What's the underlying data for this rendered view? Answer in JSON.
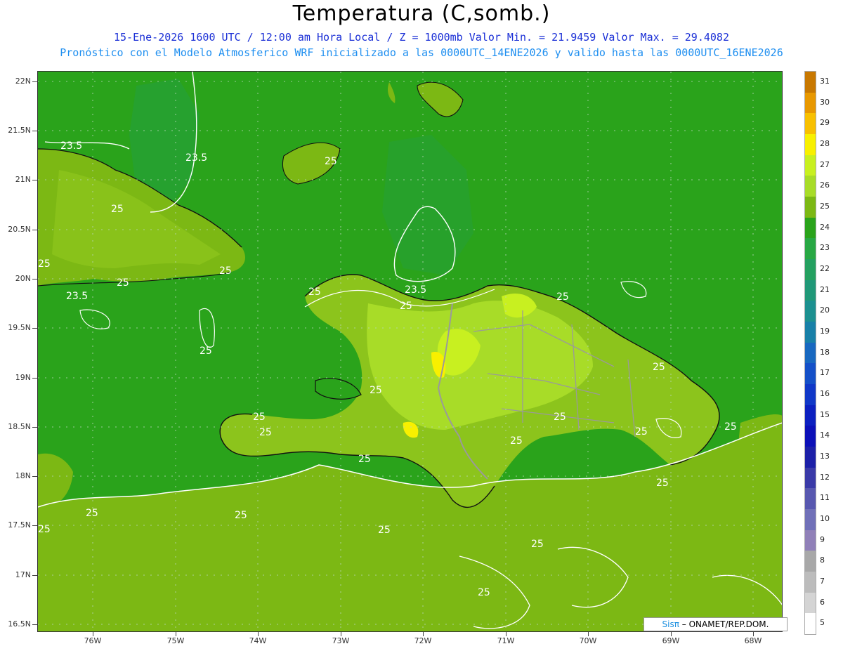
{
  "header": {
    "title": "Temperatura (C,somb.)",
    "subtitle_line1": "15-Ene-2026 1600 UTC / 12:00 am Hora Local / Z = 1000mb  Valor Min. = 21.9459  Valor Max. = 29.4082",
    "subtitle_line2": "Pronóstico con el Modelo Atmosferico WRF inicializado a las 0000UTC_14ENE2026 y valido hasta las  0000UTC_16ENE2026"
  },
  "axes": {
    "y_labels": [
      "22N",
      "21.5N",
      "21N",
      "20.5N",
      "20N",
      "19.5N",
      "19N",
      "18.5N",
      "18N",
      "17.5N",
      "17N",
      "16.5N"
    ],
    "x_labels": [
      "76W",
      "75W",
      "74W",
      "73W",
      "72W",
      "71W",
      "70W",
      "69W",
      "68W"
    ]
  },
  "contour_labels": [
    "23.5",
    "23.5",
    "25",
    "25",
    "25",
    "25",
    "23.5",
    "25",
    "25",
    "25",
    "23.5",
    "25",
    "25",
    "25",
    "25",
    "25",
    "25",
    "25",
    "25",
    "25",
    "25",
    "25",
    "25",
    "25",
    "25",
    "25",
    "25",
    "25",
    "25"
  ],
  "colorbar": {
    "labels": [
      "31",
      "30",
      "29",
      "28",
      "27",
      "26",
      "25",
      "24",
      "23",
      "22",
      "21",
      "20",
      "19",
      "18",
      "17",
      "16",
      "15",
      "14",
      "13",
      "12",
      "11",
      "10",
      "9",
      "8",
      "7",
      "6",
      "5"
    ],
    "colors": [
      "#c87800",
      "#e89800",
      "#f8c000",
      "#f8f000",
      "#c8f020",
      "#a8dc28",
      "#7cb814",
      "#2aa31b",
      "#28a844",
      "#24a060",
      "#209878",
      "#1c9090",
      "#1880a8",
      "#1868c0",
      "#1450c8",
      "#1038c8",
      "#0c20c0",
      "#0c10b8",
      "#1c20a8",
      "#3a3aa8",
      "#5858b0",
      "#7070b8",
      "#9080b8",
      "#a8a8a8",
      "#bcbcbc",
      "#d4d4d4",
      "#ffffff"
    ]
  },
  "credit": {
    "sis": "Sisπ",
    "rest": " – ONAMET/REP.DOM."
  },
  "colors": {
    "sea_green": "#2aa31b",
    "land_olive": "#7cb814",
    "warm_yellow": "#c8f020",
    "contour_white": "#ffffff",
    "border_gray": "#9a9a9a"
  }
}
